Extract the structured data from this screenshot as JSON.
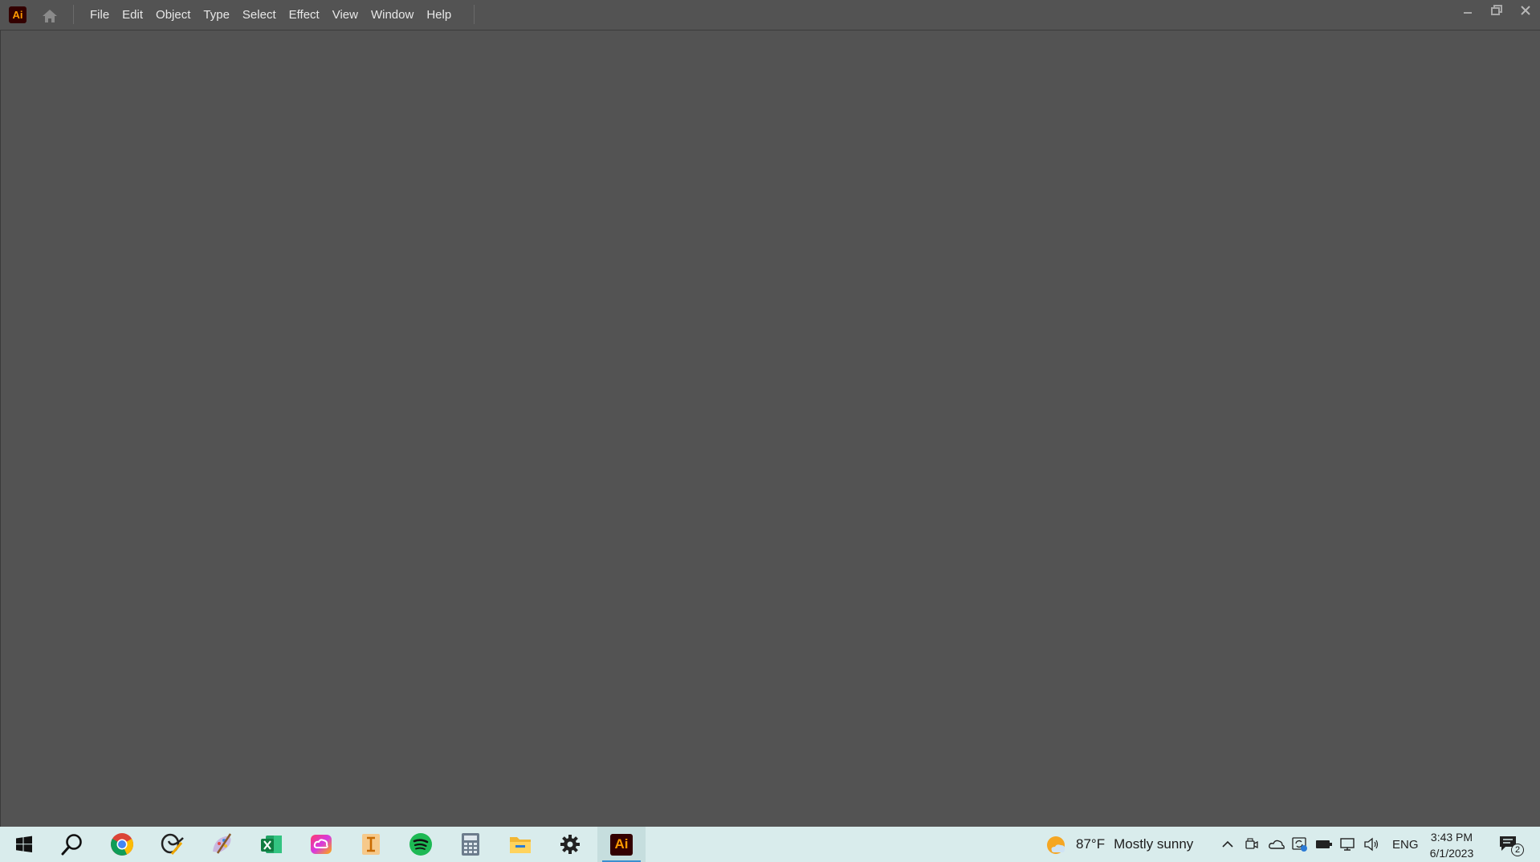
{
  "app": {
    "logo_text": "Ai",
    "menu": [
      "File",
      "Edit",
      "Object",
      "Type",
      "Select",
      "Effect",
      "View",
      "Window",
      "Help"
    ]
  },
  "taskbar": {
    "apps": [
      {
        "name": "Start",
        "icon": "windows-icon"
      },
      {
        "name": "Search",
        "icon": "search-icon"
      },
      {
        "name": "Google Chrome",
        "icon": "chrome-icon"
      },
      {
        "name": "Office app",
        "icon": "office-app-icon"
      },
      {
        "name": "Paint",
        "icon": "paint-icon"
      },
      {
        "name": "Excel",
        "icon": "excel-icon"
      },
      {
        "name": "Creative Cloud",
        "icon": "creative-cloud-icon"
      },
      {
        "name": "Text app",
        "icon": "text-app-icon"
      },
      {
        "name": "Spotify",
        "icon": "spotify-icon"
      },
      {
        "name": "Calculator",
        "icon": "calculator-icon"
      },
      {
        "name": "File Explorer",
        "icon": "folder-icon"
      },
      {
        "name": "Settings",
        "icon": "gear-icon"
      },
      {
        "name": "Illustrator",
        "icon": "illustrator-icon",
        "label": "Ai",
        "active": true
      }
    ],
    "weather": {
      "temp": "87°F",
      "condition": "Mostly sunny"
    },
    "language": "ENG",
    "time": "3:43 PM",
    "date": "6/1/2023",
    "notifications_count": "2"
  },
  "colors": {
    "workspace": "#535353",
    "taskbar": "#d9ecec",
    "illustrator_bg": "#330000",
    "illustrator_fg": "#ff9a00"
  }
}
